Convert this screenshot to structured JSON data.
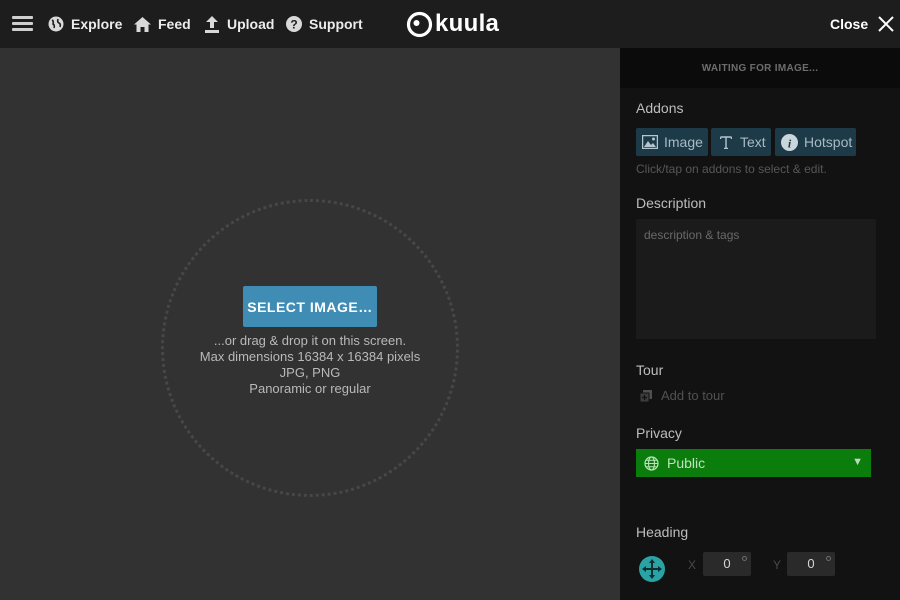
{
  "header": {
    "menu_icon": "hamburger-icon",
    "nav": [
      {
        "label": "Explore",
        "icon": "globe-icon"
      },
      {
        "label": "Feed",
        "icon": "home-icon"
      },
      {
        "label": "Upload",
        "icon": "upload-icon"
      },
      {
        "label": "Support",
        "icon": "help-icon"
      }
    ],
    "logo_text": "kuula",
    "close_label": "Close"
  },
  "upload": {
    "button_label": "SELECT IMAGE…",
    "lines": [
      "...or drag & drop it on this screen.",
      "Max dimensions 16384 x 16384 pixels",
      "JPG, PNG",
      "Panoramic or regular"
    ]
  },
  "panel": {
    "status": "WAITING FOR IMAGE...",
    "addons": {
      "title": "Addons",
      "buttons": [
        {
          "label": "Image",
          "icon": "image-icon"
        },
        {
          "label": "Text",
          "icon": "text-icon"
        },
        {
          "label": "Hotspot",
          "icon": "info-icon"
        }
      ],
      "hint": "Click/tap on addons to select & edit."
    },
    "description": {
      "title": "Description",
      "placeholder": "description & tags",
      "value": ""
    },
    "tour": {
      "title": "Tour",
      "action": "Add to tour"
    },
    "privacy": {
      "title": "Privacy",
      "value": "Public",
      "color": "#0b7d0c"
    },
    "heading": {
      "title": "Heading",
      "x_label": "X",
      "y_label": "Y",
      "x": "0",
      "y": "0"
    }
  },
  "colors": {
    "accent_button": "#3f8db4",
    "addon_button": "#1d3a49",
    "stage_bg": "#323232",
    "panel_bg": "#121212"
  }
}
